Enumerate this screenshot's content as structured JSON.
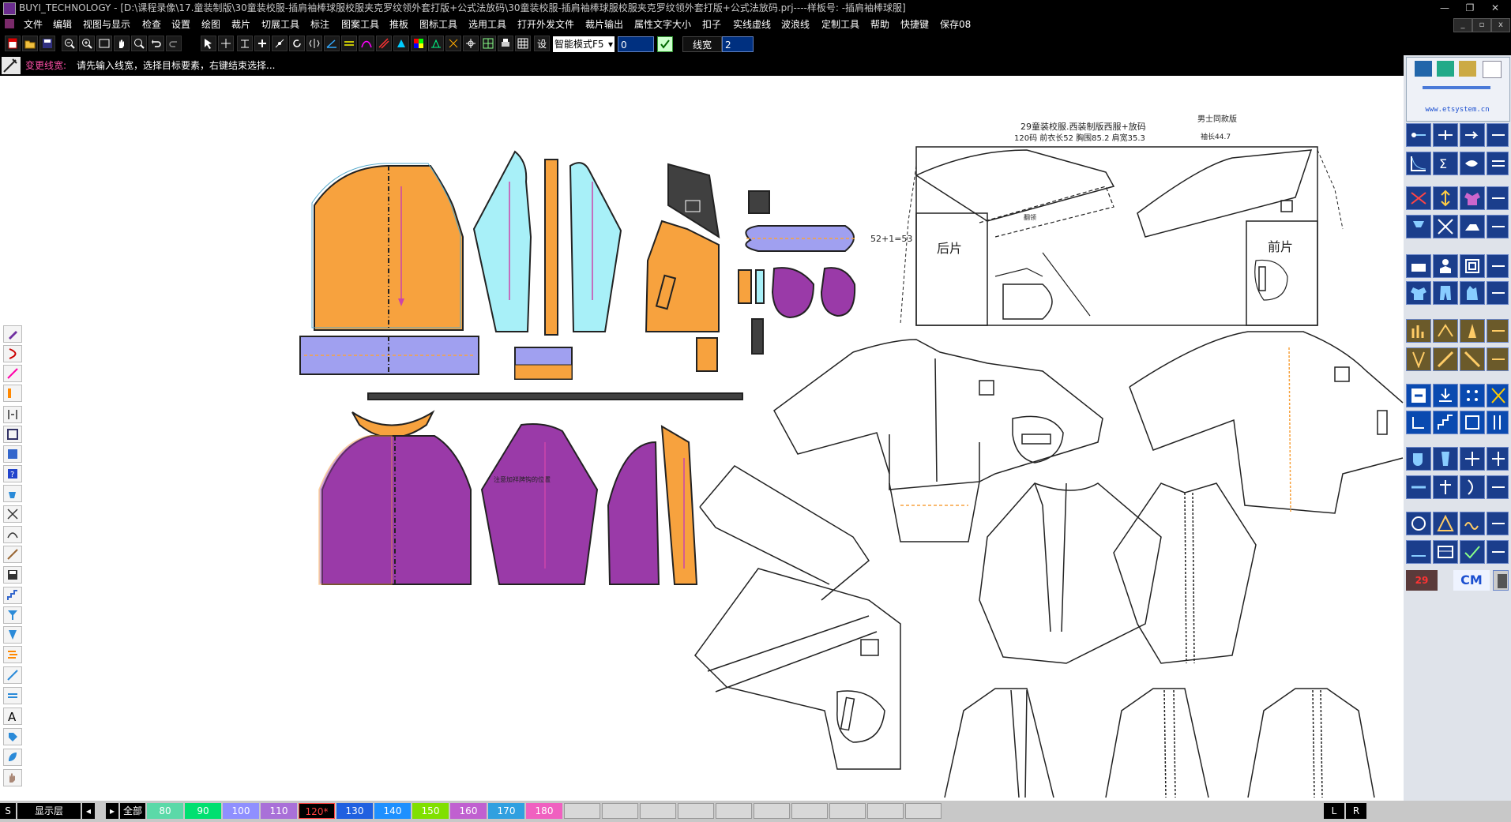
{
  "window": {
    "title": "BUYI_TECHNOLOGY - [D:\\课程录像\\17.童装制版\\30童装校服-插肩袖棒球服校服夹克罗纹领外套打版+公式法放码\\30童装校服-插肩袖棒球服校服夹克罗纹领外套打版+公式法放码.prj----样板号: -插肩袖棒球服]",
    "minimize_glyph": "—",
    "restore_glyph": "❐",
    "close_glyph": "✕"
  },
  "menu": [
    "文件",
    "编辑",
    "视图与显示",
    "检查",
    "设置",
    "绘图",
    "裁片",
    "切展工具",
    "标注",
    "图案工具",
    "推板",
    "图标工具",
    "选用工具",
    "打开外发文件",
    "裁片输出",
    "属性文字大小",
    "扣子",
    "实线虚线",
    "波浪线",
    "定制工具",
    "帮助",
    "快捷键",
    "保存08"
  ],
  "toolbar": {
    "mode_select": "智能模式F5",
    "field_value": "0",
    "linewidth_label": "线宽",
    "linewidth_value": "2"
  },
  "prompt": {
    "command": "变更线宽:",
    "message": "请先输入线宽，选择目标要素，右键结束选择..."
  },
  "right_panel": {
    "url": "www.etsystem.cn",
    "badge_left": "29",
    "badge_right": "CM"
  },
  "status": {
    "s_label": "S",
    "layer_label": "显示层",
    "all_label": "全部",
    "sizes": [
      "80",
      "90",
      "100",
      "110",
      "120*",
      "130",
      "140",
      "150",
      "160",
      "170",
      "180"
    ],
    "size_colors": [
      "#5bd9a8",
      "#00e070",
      "#8f8fff",
      "#a970d8",
      "#000000",
      "#2060e0",
      "#1e90ff",
      "#80e000",
      "#c060d0",
      "#30a0e0",
      "#f060c0"
    ],
    "size_text_colors": [
      "#fff",
      "#fff",
      "#fff",
      "#fff",
      "#ff4040",
      "#fff",
      "#fff",
      "#fff",
      "#fff",
      "#fff",
      "#fff"
    ],
    "l_label": "L",
    "r_label": "R"
  },
  "drawing": {
    "title_line1": "29童装校服.西装制版西服+放码",
    "title_line2": "120码   前衣长52   胸围85.2   肩宽35.3",
    "top_right_note": "男士同款版",
    "top_right_note2": "袖长44.7",
    "back_label": "后片",
    "front_label": "前片",
    "left_dim": "52+1=53",
    "collar_label": "翻领",
    "piece_note": "注意加袢牌钩的位置"
  },
  "colors": {
    "orange": "#f7a23e",
    "cyan": "#a8f0f8",
    "purple": "#9a3aa8",
    "lavender": "#a0a0f0",
    "dark": "#404040"
  }
}
